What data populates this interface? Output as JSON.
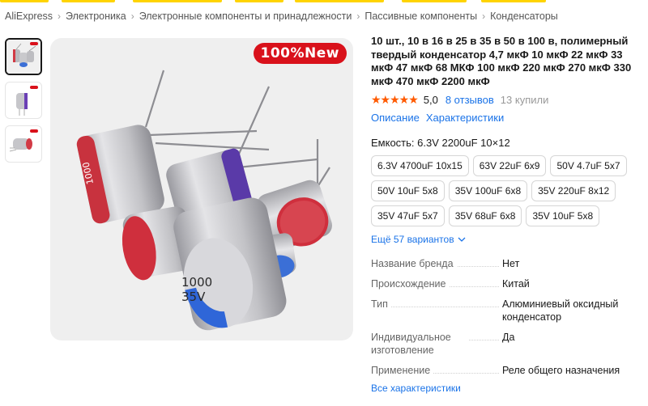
{
  "breadcrumb": [
    "AliExpress",
    "Электроника",
    "Электронные компоненты и принадлежности",
    "Пассивные компоненты",
    "Конденсаторы"
  ],
  "gallery": {
    "badge": "100%New",
    "caps": [
      "1000",
      "35V"
    ]
  },
  "product": {
    "title": "10 шт., 10 в 16 в 25 в 35 в 50 в 100 в, полимерный твердый конденсатор 4,7 мкФ 10 мкФ 22 мкФ 33 мкФ 47 мкФ 68 МКФ 100 мкФ 220 мкФ 270 мкФ 330 мкФ 470 мкФ 2200 мкФ",
    "stars": "★★★★★",
    "rating": "5,0",
    "reviews": "8 отзывов",
    "sold": "13 купили",
    "link_description": "Описание",
    "link_specs": "Характеристики"
  },
  "capacity": {
    "label": "Емкость: 6.3V 2200uF 10×12"
  },
  "variants": [
    "6.3V 4700uF 10x15",
    "63V 22uF 6x9",
    "50V 4.7uF 5x7",
    "50V 10uF 5x8",
    "35V 100uF 6x8",
    "35V 220uF 8x12",
    "35V 47uF 5x7",
    "35V 68uF 6x8",
    "35V 10uF 5x8"
  ],
  "more_variants": "Ещё 57 вариантов",
  "specs": [
    {
      "k": "Название бренда",
      "v": "Нет"
    },
    {
      "k": "Происхождение",
      "v": "Китай"
    },
    {
      "k": "Тип",
      "v": "Алюминиевый оксидный конденсатор"
    },
    {
      "k": "Индивидуальное изготовление",
      "v": "Да"
    },
    {
      "k": "Применение",
      "v": "Реле общего назначения"
    }
  ],
  "all_specs": "Все характеристики",
  "colors": {
    "accent": "#1a73e8",
    "star": "#ff5a00",
    "badge": "#d9111b"
  }
}
